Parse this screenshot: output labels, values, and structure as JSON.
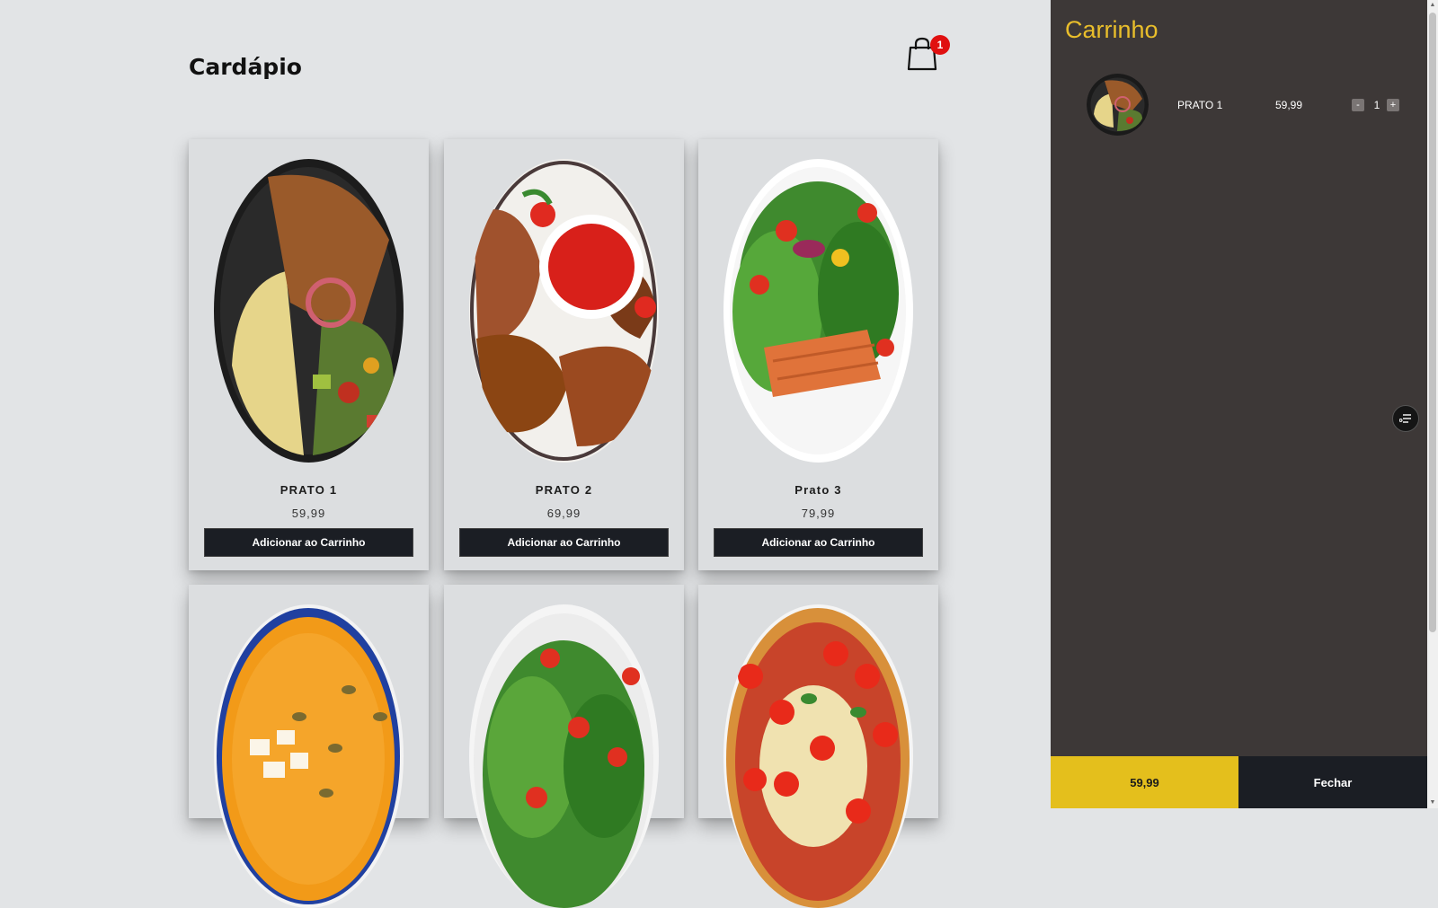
{
  "menu": {
    "title": "Cardápio",
    "cart_count": "1",
    "add_button_label": "Adicionar ao Carrinho",
    "products": [
      {
        "name": "PRATO 1",
        "price": "59,99"
      },
      {
        "name": "PRATO 2",
        "price": "69,99"
      },
      {
        "name": "Prato 3",
        "price": "79,99"
      },
      {
        "name": "",
        "price": ""
      },
      {
        "name": "",
        "price": ""
      },
      {
        "name": "",
        "price": ""
      }
    ]
  },
  "cart": {
    "title": "Carrinho",
    "items": [
      {
        "name": "PRATO 1",
        "price": "59,99",
        "quantity": "1"
      }
    ],
    "minus_label": "-",
    "plus_label": "+",
    "total": "59,99",
    "close_label": "Fechar"
  },
  "colors": {
    "page_bg": "#e2e4e6",
    "panel_bg": "#3d3837",
    "accent_yellow": "#e4bf1c",
    "button_dark": "#1b1e24",
    "badge_red": "#e01010"
  },
  "icons": {
    "cart": "shopping-bag-icon",
    "floating": "filter-list-icon"
  }
}
